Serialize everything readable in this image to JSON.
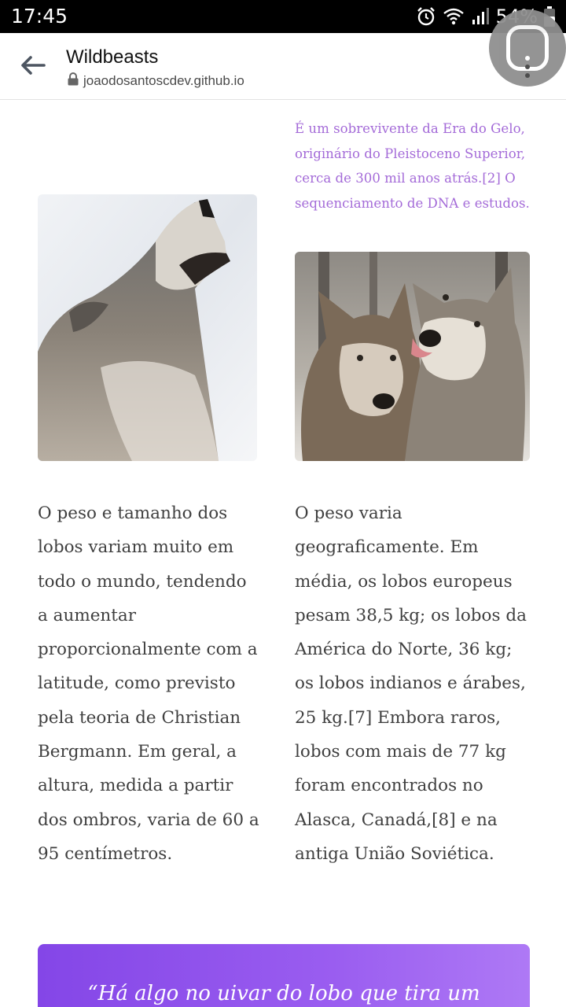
{
  "status_bar": {
    "time": "17:45",
    "battery": "54%"
  },
  "browser": {
    "title": "Wildbeasts",
    "url": "joaodosantoscdev.github.io"
  },
  "content": {
    "intro": "É um sobrevivente da Era do Gelo, originário do Pleistoceno Superior, cerca de 300 mil anos atrás.[2] O sequenciamento de DNA e estudos.",
    "paragraph_left": "O peso e tamanho dos lobos variam muito em todo o mundo, tendendo a aumentar proporcionalmente com a latitude, como previsto pela teoria de Christian Bergmann. Em geral, a altura, medida a partir dos ombros, varia de 60 a 95 centímetros.",
    "paragraph_right": "O peso varia geograficamente. Em média, os lobos europeus pesam 38,5 kg; os lobos da América do Norte, 36 kg; os lobos indianos e árabes, 25 kg.[7] Embora raros, lobos com mais de 77 kg foram encontrados no Alasca, Canadá,[8] e na antiga União Soviética.",
    "quote": "“Há algo no uivar do lobo que tira um"
  },
  "colors": {
    "accent": "#a46bd8",
    "quote_gradient_start": "#8446e7",
    "quote_gradient_end": "#ae79f5"
  }
}
